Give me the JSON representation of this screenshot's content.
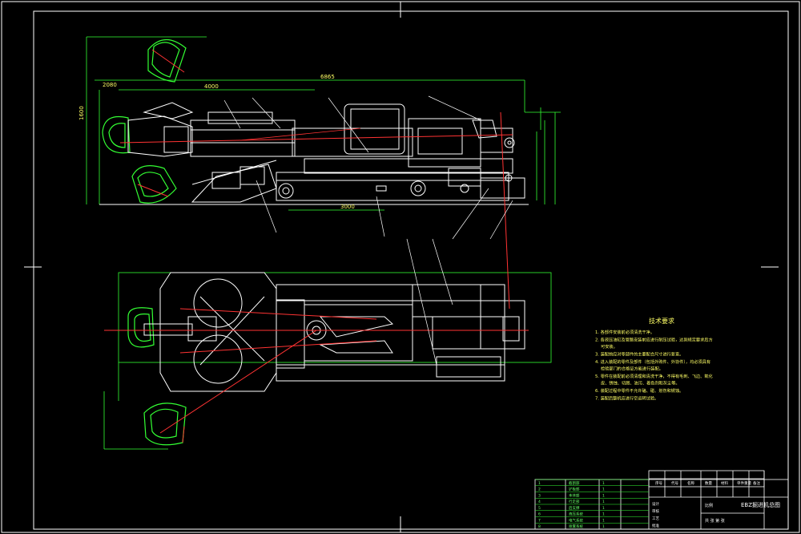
{
  "dimensions": {
    "overall_length": "6865",
    "length_a": "4000",
    "length_b": "2080",
    "height": "1600",
    "crawler_length": "3000"
  },
  "tech_req": {
    "title": "技术要求",
    "lines": [
      "1. 各部件安装前必须清洗干净。",
      "2. 各液压油缸及管路安装前应进行耐压试验，达到规定要求后方可安装。",
      "3. 装配前应对零部件的主要配合尺寸进行复查。",
      "4. 进入装配的零件及部件（包括外购件、外协件），均必须具有检验部门的合格证方能进行装配。",
      "5. 零件在装配前必须清理和清洗干净，不得有毛刺、飞边、氧化皮、锈蚀、切屑、油污、着色剂和灰尘等。",
      "6. 装配过程中零件不允许磕、碰、划伤和锈蚀。",
      "7. 装配后整机应进行空运转试验。"
    ]
  },
  "title_block": {
    "drawing_name": "EBZ掘进机总图",
    "headers": [
      "序号",
      "代号",
      "名称",
      "数量",
      "材料",
      "单件重量",
      "备注"
    ],
    "rows": [
      [
        "1",
        "",
        "截割部",
        "1",
        ""
      ],
      [
        "2",
        "",
        "铲板部",
        "1",
        ""
      ],
      [
        "3",
        "",
        "本体部",
        "1",
        ""
      ],
      [
        "4",
        "",
        "行走部",
        "1",
        ""
      ],
      [
        "5",
        "",
        "后支撑",
        "1",
        ""
      ],
      [
        "6",
        "",
        "液压系统",
        "1",
        ""
      ],
      [
        "7",
        "",
        "电气系统",
        "1",
        ""
      ],
      [
        "8",
        "",
        "喷雾系统",
        "1",
        ""
      ]
    ],
    "sign_labels": [
      "设计",
      "审核",
      "工艺",
      "批准"
    ],
    "scale_label": "比例",
    "sheet_label": "共 张 第 张"
  }
}
